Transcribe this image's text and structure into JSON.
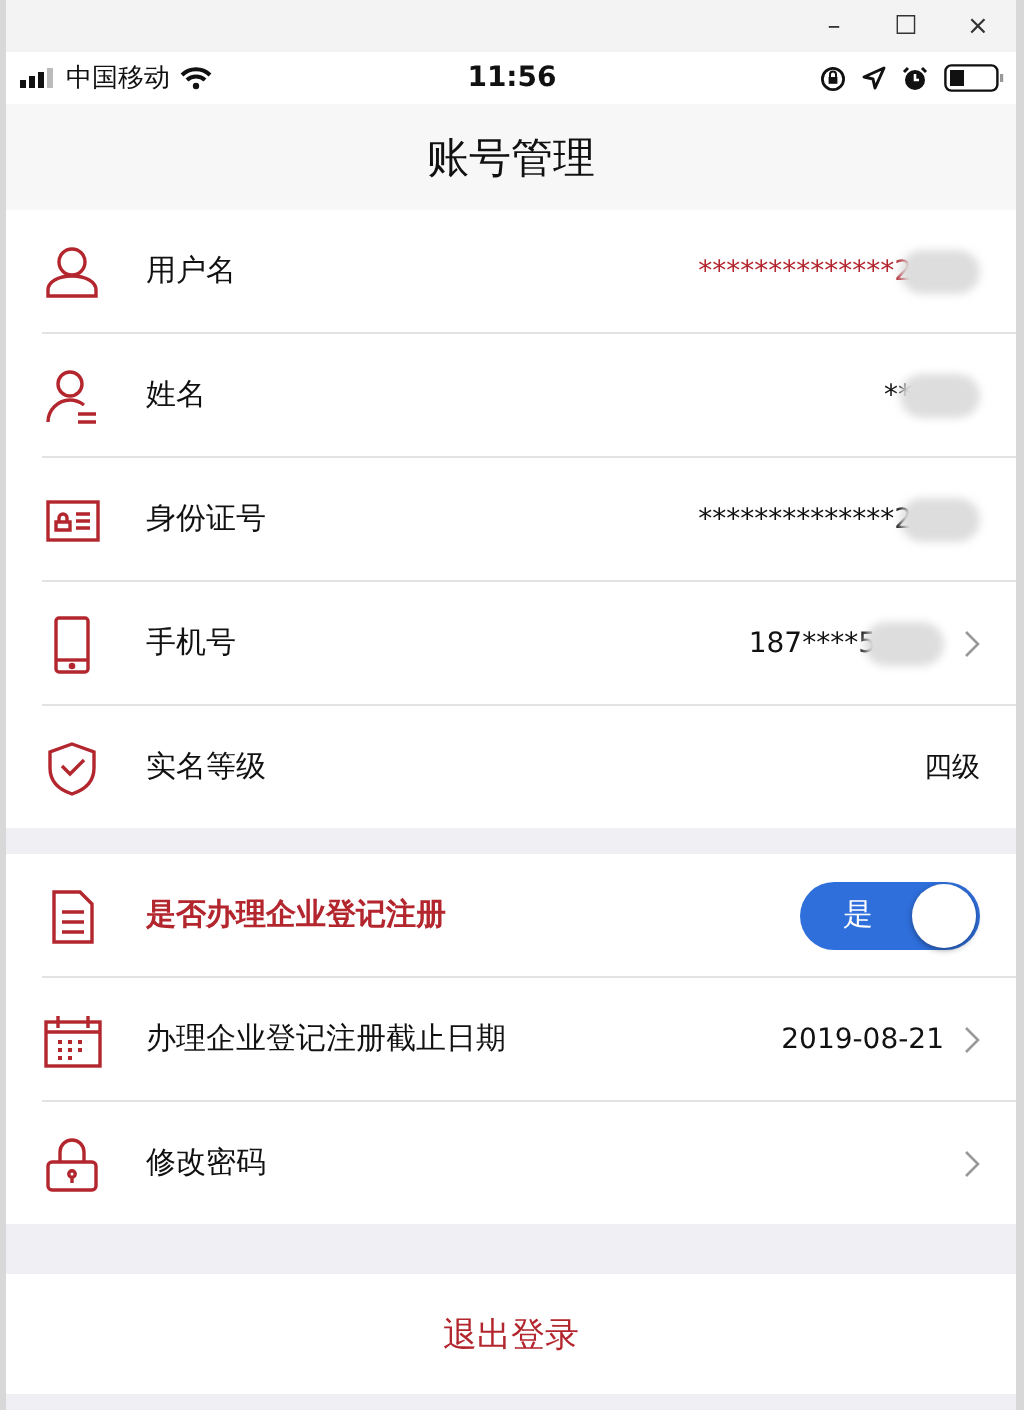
{
  "window": {
    "controls": [
      "–",
      "☐",
      "×"
    ]
  },
  "status_bar": {
    "carrier": "中国移动",
    "time": "11:56"
  },
  "title": "账号管理",
  "sections": [
    [
      {
        "label": "用户名",
        "kind": "text",
        "value": "**************2",
        "color": "#b3262e",
        "blurred": true
      },
      {
        "label": "姓名",
        "kind": "text",
        "value": "**",
        "color": "#111111",
        "blurred": true
      },
      {
        "label": "身份证号",
        "kind": "text",
        "value": "**************2",
        "color": "#111111",
        "blurred": true
      },
      {
        "label": "手机号",
        "kind": "link",
        "value": "187****5",
        "color": "#111111",
        "blurred": true
      },
      {
        "label": "实名等级",
        "kind": "text",
        "value": "四级",
        "color": "#111111",
        "blurred": false
      }
    ],
    [
      {
        "label": "是否办理企业登记注册",
        "kind": "toggle",
        "on": true,
        "toggle_label": "是"
      },
      {
        "label": "办理企业登记注册截止日期",
        "kind": "link",
        "value": "2019-08-21",
        "color": "#111111",
        "blurred": false
      },
      {
        "label": "修改密码",
        "kind": "link",
        "blurred": false
      }
    ]
  ],
  "logout": "退出登录"
}
